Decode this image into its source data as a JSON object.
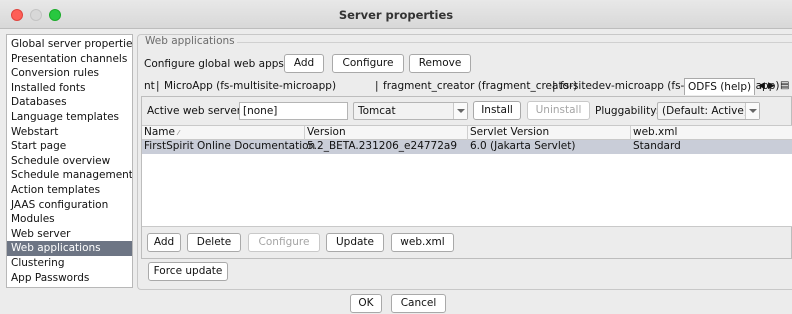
{
  "window": {
    "title": "Server properties"
  },
  "sidebar": {
    "items": [
      {
        "label": "Global server properties",
        "selected": false
      },
      {
        "label": "Presentation channels",
        "selected": false
      },
      {
        "label": "Conversion rules",
        "selected": false
      },
      {
        "label": "Installed fonts",
        "selected": false
      },
      {
        "label": "Databases",
        "selected": false
      },
      {
        "label": "Language templates",
        "selected": false
      },
      {
        "label": "Webstart",
        "selected": false
      },
      {
        "label": "Start page",
        "selected": false
      },
      {
        "label": "Schedule overview",
        "selected": false
      },
      {
        "label": "Schedule management",
        "selected": false
      },
      {
        "label": "Action templates",
        "selected": false
      },
      {
        "label": "JAAS configuration",
        "selected": false
      },
      {
        "label": "Modules",
        "selected": false
      },
      {
        "label": "Web server",
        "selected": false
      },
      {
        "label": "Web applications",
        "selected": true
      },
      {
        "label": "Clustering",
        "selected": false
      },
      {
        "label": "App Passwords",
        "selected": false
      }
    ]
  },
  "webapps": {
    "group_title": "Web applications",
    "configure_label": "Configure global web apps:",
    "add_label": "Add",
    "configure_btn": "Configure",
    "remove_label": "Remove"
  },
  "tabs": {
    "items": [
      "nt",
      "MicroApp (fs-multisite-microapp)",
      "fragment_creator (fragment_creator)",
      "fs-sitedev-microapp (fs-sitedev-microapp)",
      "ODFS (help)"
    ],
    "active_index": 4
  },
  "server_row": {
    "active_label": "Active web server:",
    "active_value": "[none]",
    "server_combo": "Tomcat",
    "install_label": "Install",
    "uninstall_label": "Uninstall",
    "pluggability_label": "Pluggability:",
    "pluggability_value": "(Default: Active)"
  },
  "table": {
    "columns": [
      "Name",
      "Version",
      "Servlet Version",
      "web.xml"
    ],
    "rows": [
      [
        "FirstSpirit Online Documentation",
        "5.2_BETA.231206_e24772a9",
        "6.0 (Jakarta Servlet)",
        "Standard"
      ]
    ]
  },
  "table_actions": {
    "add": "Add",
    "delete": "Delete",
    "configure": "Configure",
    "update": "Update",
    "webxml": "web.xml"
  },
  "force_update": "Force update",
  "footer": {
    "ok": "OK",
    "cancel": "Cancel"
  },
  "colors": {
    "selection": "#6d7584",
    "row_selection": "#c9cdd8",
    "close": "#fe5f57",
    "maximize": "#28c840"
  }
}
